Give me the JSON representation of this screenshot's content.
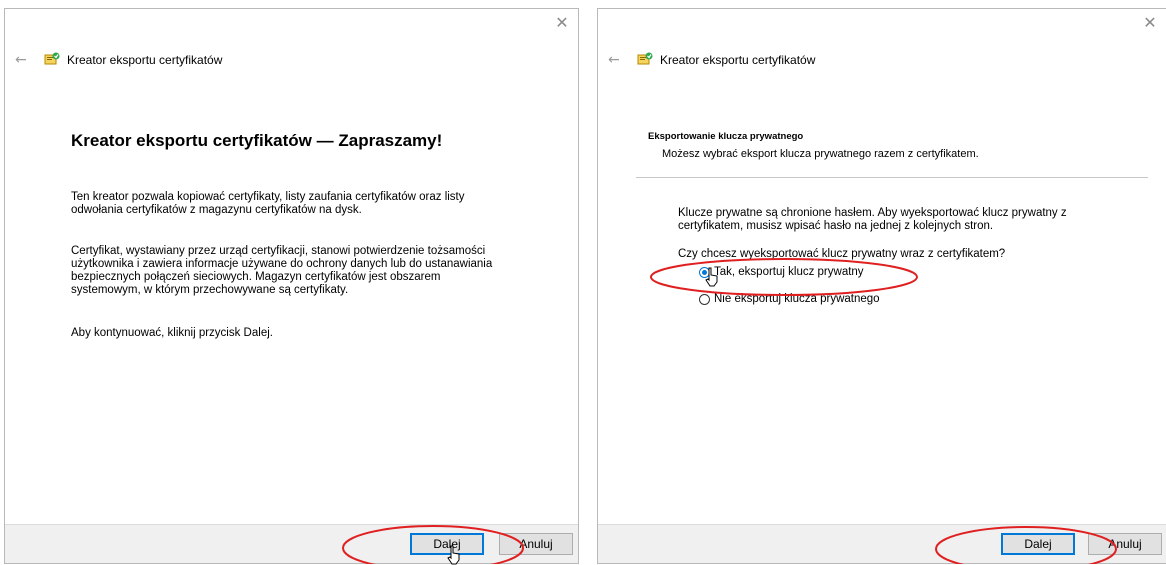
{
  "left_window": {
    "close_glyph": "✕",
    "back_glyph": "←",
    "title": "Kreator eksportu certyfikatów",
    "heading": "Kreator eksportu certyfikatów — Zapraszamy!",
    "paragraph1": "Ten kreator pozwala kopiować certyfikaty, listy zaufania certyfikatów oraz listy odwołania certyfikatów z magazynu certyfikatów na dysk.",
    "paragraph2": "Certyfikat, wystawiany przez urząd certyfikacji, stanowi potwierdzenie tożsamości użytkownika i zawiera informacje używane do ochrony danych lub do ustanawiania bezpiecznych połączeń sieciowych. Magazyn certyfikatów jest obszarem systemowym, w którym przechowywane są certyfikaty.",
    "paragraph3": "Aby kontynuować, kliknij przycisk Dalej.",
    "next_label": "Dalej",
    "cancel_label": "Anuluj"
  },
  "right_window": {
    "close_glyph": "✕",
    "back_glyph": "←",
    "title": "Kreator eksportu certyfikatów",
    "section_title": "Eksportowanie klucza prywatnego",
    "section_subtitle": "Możesz wybrać eksport klucza prywatnego razem z certyfikatem.",
    "paragraph": "Klucze prywatne są chronione hasłem. Aby wyeksportować klucz prywatny z certyfikatem, musisz wpisać hasło na jednej z kolejnych stron.",
    "question": "Czy chcesz wyeksportować klucz prywatny wraz z certyfikatem?",
    "options": [
      {
        "label": "Tak, eksportuj klucz prywatny",
        "checked": true
      },
      {
        "label": "Nie eksportuj klucza prywatnego",
        "checked": false
      }
    ],
    "next_label": "Dalej",
    "cancel_label": "Anuluj"
  },
  "icons": {
    "close": "close-icon",
    "back": "back-arrow-icon",
    "wizard": "certificate-wizard-icon",
    "cursor": "mouse-cursor-icon"
  },
  "colors": {
    "accent": "#0078d7",
    "annotation": "#e02020",
    "footer_bg": "#f0f0f0"
  }
}
